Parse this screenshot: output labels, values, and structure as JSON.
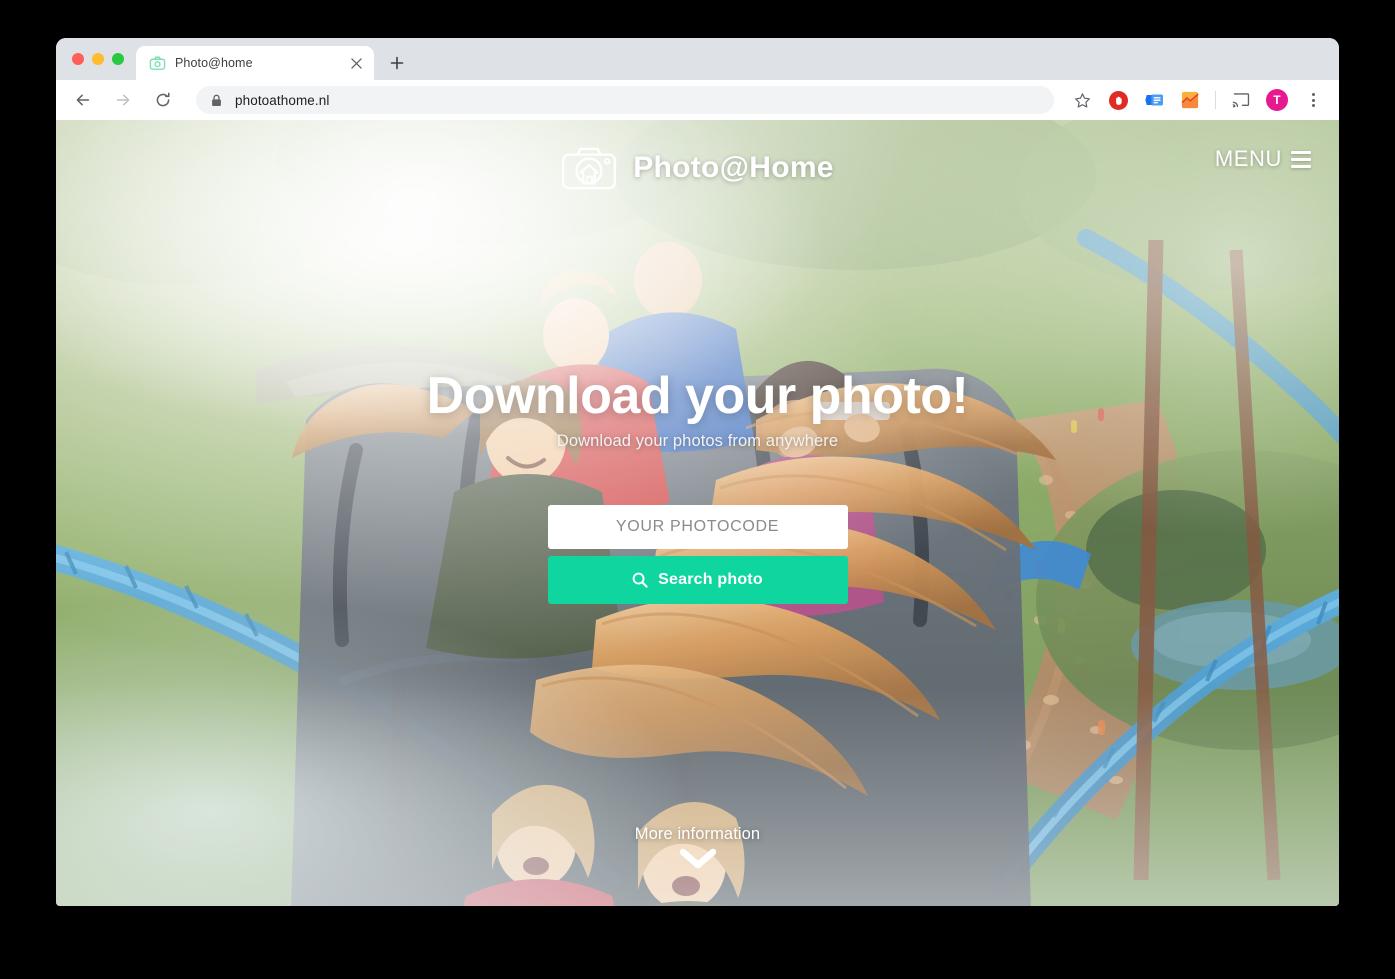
{
  "browser": {
    "tab": {
      "title": "Photo@home",
      "favicon_icon": "camera-icon",
      "close_icon": "close-icon"
    },
    "new_tab_icon": "plus-icon",
    "back_icon": "arrow-left-icon",
    "forward_icon": "arrow-right-icon",
    "reload_icon": "reload-icon",
    "omnibox": {
      "security_icon": "lock-icon",
      "url": "photoathome.nl"
    },
    "toolbar_icons": [
      {
        "name": "bookmark-star-icon",
        "label": "star"
      },
      {
        "name": "adblock-extension-icon",
        "label": "hand"
      },
      {
        "name": "card-extension-icon",
        "label": "card"
      },
      {
        "name": "chart-extension-icon",
        "label": "chart"
      },
      {
        "name": "cast-icon",
        "label": "cast"
      }
    ],
    "profile_initial": "T",
    "menu_icon": "kebab-menu-icon",
    "colors": {
      "tabstrip": "#dee1e6",
      "omnibox": "#f1f3f4",
      "adblock_red": "#e02a24",
      "avatar_pink": "#e8188e"
    }
  },
  "site": {
    "brand": {
      "logo_icon": "camera-house-logo-icon",
      "name": "Photo@Home"
    },
    "menu": {
      "label": "MENU",
      "icon": "hamburger-icon"
    },
    "hero": {
      "title": "Download your photo!",
      "subtitle": "Download your photos from anywhere"
    },
    "search": {
      "input_placeholder": "YOUR PHOTOCODE",
      "input_value": "",
      "button_label": "Search photo",
      "button_icon": "search-icon",
      "button_color": "#0ed69e"
    },
    "more_info": {
      "label": "More information",
      "icon": "chevron-down-icon"
    },
    "background": {
      "description": "Roller coaster riders with wind-blown hair over a theme park landscape with blue track"
    }
  }
}
